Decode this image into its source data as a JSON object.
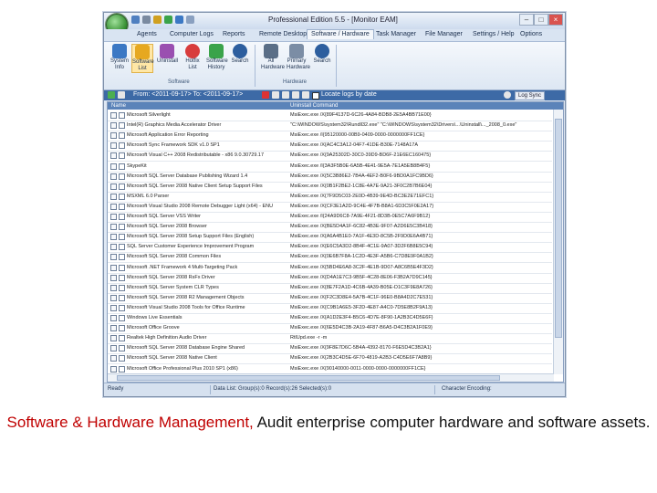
{
  "window": {
    "title": "Professional Edition 5.5 - [Monitor EAM]",
    "controls": [
      "–",
      "□",
      "×"
    ]
  },
  "menu_tabs": [
    "Agents",
    "Computer Logs",
    "Reports",
    "Remote Desktop",
    "Software / Hardware",
    "Task Manager",
    "File Manager",
    "Settings / Help"
  ],
  "menu_active": "Software / Hardware",
  "menu_options": "Options",
  "ribbon": {
    "buttons": [
      {
        "line1": "System",
        "line2": "Info",
        "icon": "system-info-icon",
        "color": "#3b78c4"
      },
      {
        "line1": "Software",
        "line2": "List",
        "icon": "software-list-icon",
        "color": "#e6a820"
      },
      {
        "line1": "Uninstall",
        "line2": "",
        "icon": "uninstall-icon",
        "color": "#9a4fb0"
      },
      {
        "line1": "Hotfix",
        "line2": "List",
        "icon": "hotfix-icon",
        "color": "#d83c3c"
      },
      {
        "line1": "Software",
        "line2": "History",
        "icon": "software-history-icon",
        "color": "#3aa34a"
      },
      {
        "line1": "Search",
        "line2": "",
        "icon": "search-icon",
        "color": "#2d5e9e"
      },
      {
        "line1": "All",
        "line2": "Hardware",
        "icon": "all-hardware-icon",
        "color": "#5a6e86"
      },
      {
        "line1": "Primary",
        "line2": "Hardware",
        "icon": "primary-hardware-icon",
        "color": "#7b8da5"
      },
      {
        "line1": "Search",
        "line2": "",
        "icon": "search-icon",
        "color": "#2d5e9e"
      }
    ],
    "group_software": "Software",
    "group_hardware": "Hardware"
  },
  "filter_bar": {
    "range": "From: <2011-09-17> To: <2011-09-17>",
    "locate_label": "Locate logs by date",
    "log_sync": "Log Sync"
  },
  "grid": {
    "columns": [
      "Name",
      "Uninstall Command"
    ],
    "rows": [
      {
        "name": "Microsoft Silverlight",
        "cmd": "MsiExec.exe /X{89F4137D-6C26-4A84-BDB8-2E5A4BB71E00}"
      },
      {
        "name": "Intel(R) Graphics Media Accelerator Driver",
        "cmd": "\"C:\\WINDOWS\\system32\\Rundll32.exe\" \"C:\\WINDOWS\\system32\\Drivers\\...\\Uninstall\\..._2008_0.exe\""
      },
      {
        "name": "Microsoft Application Error Reporting",
        "cmd": "MsiExec.exe /I{95120000-00B9-0409-0000-0000000FF1CE}"
      },
      {
        "name": "Microsoft Sync Framework SDK v1.0 SP1",
        "cmd": "MsiExec.exe /X{AC4C3A12-04F7-41DE-B30E-7148A17A"
      },
      {
        "name": "Microsoft Visual C++ 2008 Redistributable - x86 9.0.30729.17",
        "cmd": "MsiExec.exe /X{9A25302D-30C0-39D9-BD6F-21E6EC160475}"
      },
      {
        "name": "SkypeKit",
        "cmd": "MsiExec.exe /I{3A3F5B0E-6A5B-4E41-9E5A-7E1A5EB8B4F5}"
      },
      {
        "name": "Microsoft SQL Server Database Publishing Wizard 1.4",
        "cmd": "MsiExec.exe /X{5C3B86E2-7B4A-4EF2-B0F6-9BD0A1FC9BD6}"
      },
      {
        "name": "Microsoft SQL Server 2008 Native Client Setup Support Files",
        "cmd": "MsiExec.exe /X{0B1F2BE2-1C8E-4A7E-9A21-3F0C2B7B6E04}"
      },
      {
        "name": "MSXML 6.0 Parser",
        "cmd": "MsiExec.exe /X{7F9D5C03-2E0D-4B39-9E4D-BC3E2E71EFC1}"
      },
      {
        "name": "Microsoft Visual Studio 2008 Remote Debugger Light (x64) - ENU",
        "cmd": "MsiExec.exe /X{CF3E1A2D-9C4E-4F7B-B8A1-6D3C5F0E2A17}"
      },
      {
        "name": "Microsoft SQL Server VSS Writer",
        "cmd": "MsiExec.exe /I{24A9D6C8-7A9E-4F21-8D3B-0E5C7A6F9B12}"
      },
      {
        "name": "Microsoft SQL Server 2008 Browser",
        "cmd": "MsiExec.exe /X{BE5D4A1F-6C82-4B3E-9F07-A2D6E5C3B418}"
      },
      {
        "name": "Microsoft SQL Server 2008 Setup Support Files (English)",
        "cmd": "MsiExec.exe /X{A6A4B1E0-7A1F-4E3D-8C5B-2F9D0E6A4B71}"
      },
      {
        "name": "SQL Server Customer Experience Improvement Program",
        "cmd": "MsiExec.exe /X{E6C5A3D2-8B4F-4C1E-9A07-3D2F6B8E5C94}"
      },
      {
        "name": "Microsoft SQL Server 2008 Common Files",
        "cmd": "MsiExec.exe /X{0E6B7F8A-1C2D-4E3F-A5B6-C7D8E9F0A1B2}"
      },
      {
        "name": "Microsoft .NET Framework 4 Multi-Targeting Pack",
        "cmd": "MsiExec.exe /X{5BD4E6A8-3C2F-4E1B-9D07-A8C6B5E4F3D2}"
      },
      {
        "name": "Microsoft SQL Server 2008 RsFx Driver",
        "cmd": "MsiExec.exe /X{D4A1E7C3-9B5F-4C28-8E06-F3B2A7D9C145}"
      },
      {
        "name": "Microsoft SQL Server System CLR Types",
        "cmd": "MsiExec.exe /X{8E7F2A1D-4C6B-4A39-B05E-D1C3F9E8A726}"
      },
      {
        "name": "Microsoft SQL Server 2008 R2 Management Objects",
        "cmd": "MsiExec.exe /X{F2C3D8E4-5A7B-4C1F-96E0-B8A4D2C7E531}"
      },
      {
        "name": "Microsoft Visual Studio 2008 Tools for Office Runtime",
        "cmd": "MsiExec.exe /X{C9B1A6E5-3F2D-4E87-A4C0-7D5E8B2F9A13}"
      },
      {
        "name": "Windows Live Essentials",
        "cmd": "MsiExec.exe /X{A1D2E3F4-B5C6-4D7E-8F90-1A2B3C4D5E6F}"
      },
      {
        "name": "Microsoft Office Groove",
        "cmd": "MsiExec.exe /X{6E5D4C3B-2A19-4F87-B6A5-D4C3B2A1F0E9}"
      },
      {
        "name": "Realtek High Definition Audio Driver",
        "cmd": "RtlUpd.exe -r -m"
      },
      {
        "name": "Microsoft SQL Server 2008 Database Engine Shared",
        "cmd": "MsiExec.exe /X{9F8E7D6C-5B4A-4392-8170-F6E5D4C3B2A1}"
      },
      {
        "name": "Microsoft SQL Server 2008 Native Client",
        "cmd": "MsiExec.exe /X{2B3C4D5E-6F70-4819-A2B3-C4D5E6F7A8B9}"
      },
      {
        "name": "Microsoft Office Professional Plus 2010 SP1 (x86)",
        "cmd": "MsiExec.exe /X{90140000-0011-0000-0000-0000000FF1CE}"
      }
    ]
  },
  "status": {
    "ready": "Ready",
    "data_list": "Data List: Group(s):0  Record(s):26  Selected(s):0",
    "encoding": "Character Encoding:"
  },
  "caption": {
    "red": "Software & Hardware Management,",
    "black": " Audit enterprise computer hardware and software assets."
  }
}
